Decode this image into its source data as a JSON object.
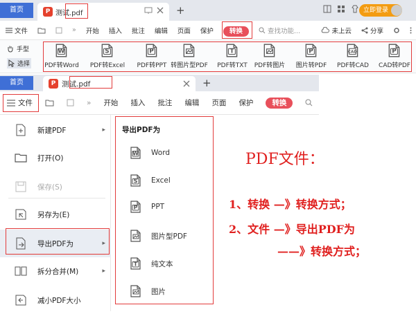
{
  "app": {
    "home_tab": "首页",
    "doc_tab_prefix": "测试",
    "doc_tab_ext": ".pdf",
    "new_tab": "+",
    "login_label": "立即登录",
    "badge": "P"
  },
  "toolbar": {
    "file_label": "文件",
    "items": [
      "开始",
      "插入",
      "批注",
      "编辑",
      "页面",
      "保护"
    ],
    "convert_label": "转换",
    "search_placeholder": "查找功能...",
    "cloud_label": "未上云",
    "share_label": "分享",
    "more_label": "»"
  },
  "side_tools": {
    "hand": "手型",
    "select": "选择"
  },
  "ribbon": {
    "items": [
      {
        "label": "PDF转Word",
        "icon": "pdf-to-word-icon",
        "glyph": "W"
      },
      {
        "label": "PDF转Excel",
        "icon": "pdf-to-excel-icon",
        "glyph": "S"
      },
      {
        "label": "PDF转PPT",
        "icon": "pdf-to-ppt-icon",
        "glyph": "P"
      },
      {
        "label": "转图片型PDF",
        "icon": "to-image-pdf-icon",
        "glyph": "img"
      },
      {
        "label": "PDF转TXT",
        "icon": "pdf-to-txt-icon",
        "glyph": "T"
      },
      {
        "label": "PDF转图片",
        "icon": "pdf-to-image-icon",
        "glyph": "img"
      },
      {
        "label": "图片转PDF",
        "icon": "image-to-pdf-icon",
        "glyph": "P"
      },
      {
        "label": "PDF转CAD",
        "icon": "pdf-to-cad-icon",
        "glyph": "CAD"
      },
      {
        "label": "CAD转PDF",
        "icon": "cad-to-pdf-icon",
        "glyph": "P"
      }
    ]
  },
  "file_menu": {
    "items": [
      {
        "label": "新建PDF",
        "icon": "new-pdf-icon",
        "arrow": true,
        "disabled": false
      },
      {
        "label": "打开(O)",
        "icon": "open-folder-icon",
        "arrow": false,
        "disabled": false
      },
      {
        "label": "保存(S)",
        "icon": "save-icon",
        "arrow": false,
        "disabled": true
      },
      {
        "label": "另存为(E)",
        "icon": "save-as-icon",
        "arrow": false,
        "disabled": false
      },
      {
        "label": "导出PDF为",
        "icon": "export-pdf-icon",
        "arrow": true,
        "disabled": false
      },
      {
        "label": "拆分合并(M)",
        "icon": "split-merge-icon",
        "arrow": true,
        "disabled": false
      },
      {
        "label": "减小PDF大小",
        "icon": "compress-pdf-icon",
        "arrow": false,
        "disabled": false
      }
    ],
    "arrow_glyph": "▸"
  },
  "export_menu": {
    "title": "导出PDF为",
    "items": [
      {
        "label": "Word",
        "icon": "word-icon",
        "glyph": "W"
      },
      {
        "label": "Excel",
        "icon": "excel-icon",
        "glyph": "S"
      },
      {
        "label": "PPT",
        "icon": "ppt-icon",
        "glyph": "P"
      },
      {
        "label": "图片型PDF",
        "icon": "image-pdf-icon",
        "glyph": "img"
      },
      {
        "label": "纯文本",
        "icon": "plain-text-icon",
        "glyph": "T"
      },
      {
        "label": "图片",
        "icon": "picture-icon",
        "glyph": "img"
      }
    ]
  },
  "annotation": {
    "heading": "PDF文件：",
    "line1": "1、转换 —》转换方式；",
    "line2": "2、文件 —》导出PDF为",
    "line3": "——》转换方式；"
  },
  "colors": {
    "accent_blue": "#3f6fd6",
    "convert_red": "#e8505b",
    "highlight_red": "#e23b3b",
    "login_orange": "#f39c12"
  }
}
